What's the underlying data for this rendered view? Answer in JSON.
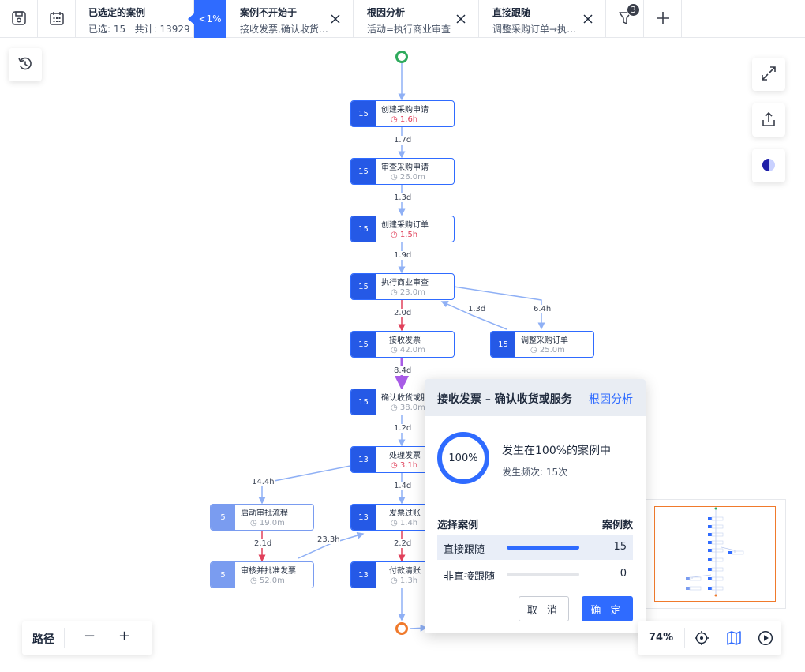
{
  "toolbar": {
    "selected": {
      "title": "已选定的案例",
      "count_text": "已选: 15",
      "total_text": "共计: 13929",
      "percent": "<1%"
    },
    "filters": [
      {
        "title": "案例不开始于",
        "value": "接收发票,确认收货或服务"
      },
      {
        "title": "根因分析",
        "value": "活动=执行商业审查"
      },
      {
        "title": "直接跟随",
        "value": "调整采购订单→执行商业审查"
      }
    ],
    "filter_badge": "3"
  },
  "graph": {
    "nodes": [
      {
        "count": "15",
        "name": "创建采购申请",
        "duration": "1.6h"
      },
      {
        "count": "15",
        "name": "审查采购申请",
        "duration": "26.0m"
      },
      {
        "count": "15",
        "name": "创建采购订单",
        "duration": "1.5h"
      },
      {
        "count": "15",
        "name": "执行商业审查",
        "duration": "23.0m"
      },
      {
        "count": "15",
        "name": "接收发票",
        "duration": "42.0m"
      },
      {
        "count": "15",
        "name": "调整采购订单",
        "duration": "25.0m"
      },
      {
        "count": "15",
        "name": "确认收货或服务",
        "duration": "38.0m"
      },
      {
        "count": "13",
        "name": "处理发票",
        "duration": "3.1h"
      },
      {
        "count": "5",
        "name": "启动审批流程",
        "duration": "19.0m"
      },
      {
        "count": "13",
        "name": "发票过账",
        "duration": "1.4h"
      },
      {
        "count": "5",
        "name": "审核并批准发票",
        "duration": "52.0m"
      },
      {
        "count": "13",
        "name": "付款清账",
        "duration": "1.3h"
      }
    ],
    "edges": [
      "1.7d",
      "1.3d",
      "1.9d",
      "2.0d",
      "1.3d",
      "6.4h",
      "8.4d",
      "1.2d",
      "14.4h",
      "1.4d",
      "2.1d",
      "23.3h",
      "2.2d"
    ]
  },
  "popup": {
    "title": "接收发票 – 确认收货或服务",
    "link": "根因分析",
    "percent": "100%",
    "occurrence": "发生在100%的案例中",
    "frequency": "发生频次:  15次",
    "col_left": "选择案例",
    "col_right": "案例数",
    "options": [
      {
        "label": "直接跟随",
        "value": "15",
        "fraction": 1.0
      },
      {
        "label": "非直接跟随",
        "value": "0",
        "fraction": 0
      }
    ],
    "cancel": "取 消",
    "ok": "确 定"
  },
  "bottom": {
    "path_label": "路径",
    "minus": "−",
    "plus": "+",
    "zoom": "74%"
  },
  "colors": {
    "accent": "#2f6bff",
    "node_dark": "#2559e6",
    "node_light": "#7a9cf0",
    "start": "#2eaa5c",
    "end": "#f07a2c"
  }
}
